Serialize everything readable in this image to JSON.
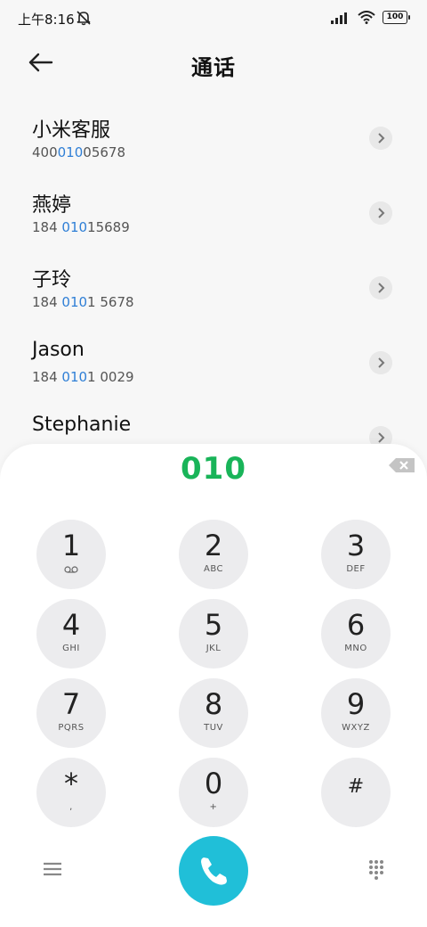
{
  "status": {
    "time": "上午8:16",
    "battery": "100"
  },
  "header": {
    "title": "通话"
  },
  "contacts": [
    {
      "name": "小米客服",
      "num_pre": "400",
      "num_hl": "010",
      "num_post": "05678"
    },
    {
      "name": "燕婷",
      "num_pre": "184 ",
      "num_hl": "010",
      "num_post": "15689"
    },
    {
      "name": "子玲",
      "num_pre": "184 ",
      "num_hl": "010",
      "num_post": "1 5678"
    },
    {
      "name": "Jason",
      "num_pre": "184 ",
      "num_hl": "010",
      "num_post": "1 0029"
    },
    {
      "name": "Stephanie",
      "num_pre": "",
      "num_hl": "",
      "num_post": ""
    }
  ],
  "dialer": {
    "input": "010",
    "keys": [
      {
        "digit": "1",
        "letters": ""
      },
      {
        "digit": "2",
        "letters": "ABC"
      },
      {
        "digit": "3",
        "letters": "DEF"
      },
      {
        "digit": "4",
        "letters": "GHI"
      },
      {
        "digit": "5",
        "letters": "JKL"
      },
      {
        "digit": "6",
        "letters": "MNO"
      },
      {
        "digit": "7",
        "letters": "PQRS"
      },
      {
        "digit": "8",
        "letters": "TUV"
      },
      {
        "digit": "9",
        "letters": "WXYZ"
      },
      {
        "digit": "*",
        "letters": ","
      },
      {
        "digit": "0",
        "letters": "+"
      },
      {
        "digit": "#",
        "letters": ""
      }
    ]
  },
  "icons": {
    "back": "arrow-left-icon",
    "mute": "bell-muted-icon",
    "signal": "signal-icon",
    "wifi": "wifi-icon",
    "chevron": "chevron-right-icon",
    "backspace": "backspace-icon",
    "voicemail": "voicemail-icon",
    "menu": "menu-icon",
    "call": "phone-icon",
    "keypad": "dialpad-icon"
  },
  "colors": {
    "match_highlight": "#2f7fd6",
    "dial_text": "#19b459",
    "call_button": "#20bfd8"
  }
}
